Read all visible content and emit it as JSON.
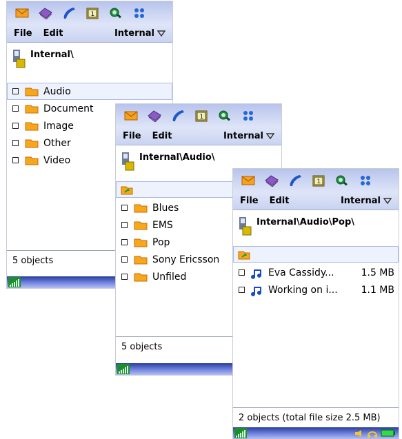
{
  "colors": {
    "appbar_top": "#b7c3ec",
    "appbar_bottom": "#dfe5f8",
    "selection": "#eef2fd",
    "bottombar": "#4f60c6"
  },
  "screen1": {
    "menu": {
      "file": "File",
      "edit": "Edit",
      "storage": "Internal"
    },
    "path": "Internal\\",
    "items": [
      {
        "label": "Audio",
        "icon": "folder-icon",
        "selected": true
      },
      {
        "label": "Document",
        "icon": "folder-icon"
      },
      {
        "label": "Image",
        "icon": "folder-icon"
      },
      {
        "label": "Other",
        "icon": "folder-icon"
      },
      {
        "label": "Video",
        "icon": "folder-icon"
      }
    ],
    "status": "5 objects"
  },
  "screen2": {
    "menu": {
      "file": "File",
      "edit": "Edit",
      "storage": "Internal"
    },
    "path": "Internal\\Audio\\",
    "items": [
      {
        "label": "Blues"
      },
      {
        "label": "EMS"
      },
      {
        "label": "Pop"
      },
      {
        "label": "Sony Ericsson"
      },
      {
        "label": "Unfiled"
      }
    ],
    "status": "5 objects"
  },
  "screen3": {
    "menu": {
      "file": "File",
      "edit": "Edit",
      "storage": "Internal"
    },
    "path": "Internal\\Audio\\Pop\\",
    "items": [
      {
        "label": "Eva Cassidy...",
        "size": "1.5 MB"
      },
      {
        "label": "Working on i...",
        "size": "1.1 MB"
      }
    ],
    "status": "2 objects (total file size 2.5 MB)"
  }
}
